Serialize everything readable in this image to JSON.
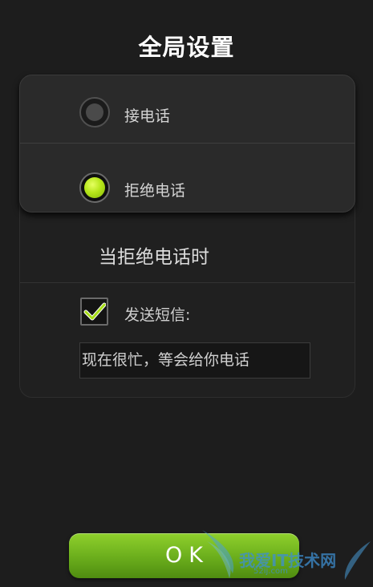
{
  "dialog": {
    "title": "全局设置"
  },
  "call_options": [
    {
      "label": "接电话",
      "selected": false
    },
    {
      "label": "拒绝电话",
      "selected": true
    }
  ],
  "on_reject": {
    "heading": "当拒绝电话时",
    "send_sms_label": "发送短信:",
    "send_sms_checked": true,
    "sms_message": "现在很忙，等会给你电话"
  },
  "ok_button": {
    "label": "OK"
  },
  "watermark": {
    "text": "我爱IT技术网",
    "sub": "52ij.com"
  },
  "colors": {
    "background": "#1d1d1d",
    "accent_green": "#b6e61a",
    "ok_button": "#6aad1c"
  }
}
